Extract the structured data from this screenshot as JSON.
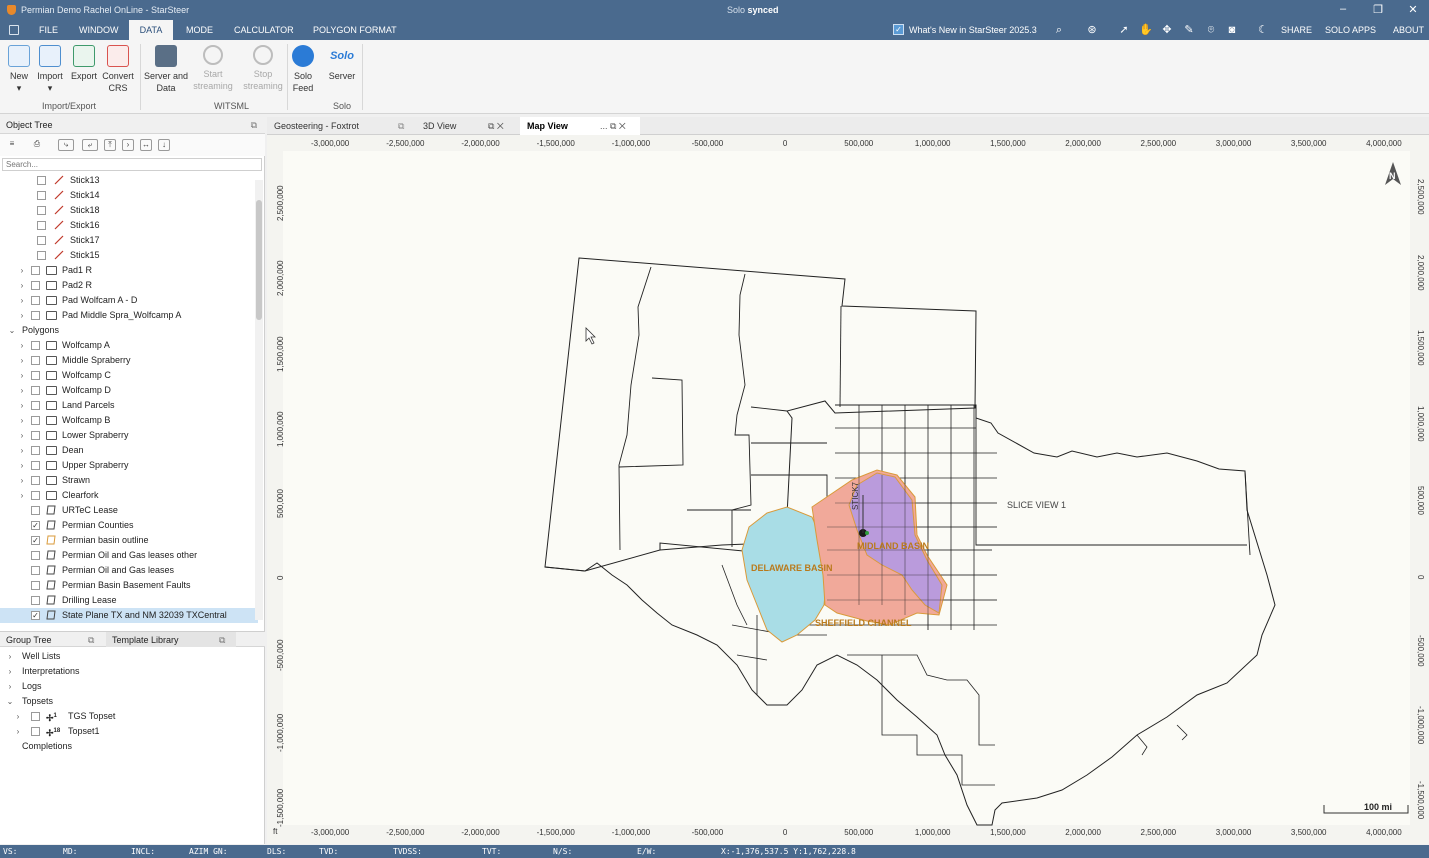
{
  "window": {
    "title": "Permian Demo Rachel OnLine - StarSteer",
    "sync_prefix": "Solo",
    "sync_status": "synced",
    "controls": [
      "–",
      "❐",
      "✕"
    ]
  },
  "menu": {
    "tabs": [
      "FILE",
      "WINDOW",
      "DATA",
      "MODE",
      "CALCULATOR",
      "POLYGON FORMAT"
    ],
    "active_tab": "DATA",
    "whats_new": "What's New in StarSteer 2025.3",
    "share": "SHARE",
    "solo_apps": "SOLO APPS",
    "about": "ABOUT"
  },
  "ribbon": {
    "groups": {
      "import_export": "Import/Export",
      "witsml": "WITSML",
      "solo": "Solo"
    },
    "buttons": {
      "new": [
        "New",
        "▾"
      ],
      "import": [
        "Import",
        "▾"
      ],
      "export": [
        "Export",
        ""
      ],
      "convert": [
        "Convert",
        "CRS"
      ],
      "server": [
        "Server and",
        "Data"
      ],
      "start": [
        "Start",
        "streaming"
      ],
      "stop": [
        "Stop",
        "streaming"
      ],
      "solo_feed": [
        "Solo",
        "Feed"
      ],
      "solo_server": [
        "Server",
        ""
      ]
    },
    "solo_logo_text": "Solo",
    "colors": {
      "new": "#6aa3d8",
      "import": "#4f8fcf",
      "export": "#3f9a6c",
      "convert": "#d9534f",
      "server": "#5a6f86",
      "solo": "#2b7bd6"
    }
  },
  "object_tree": {
    "title": "Object Tree",
    "search_placeholder": "Search...",
    "rows": [
      {
        "label": "Stick13",
        "type": "stick",
        "indent": 2,
        "expander": "",
        "checked": false
      },
      {
        "label": "Stick14",
        "type": "stick",
        "indent": 2,
        "expander": "",
        "checked": false
      },
      {
        "label": "Stick18",
        "type": "stick",
        "indent": 2,
        "expander": "",
        "checked": false
      },
      {
        "label": "Stick16",
        "type": "stick",
        "indent": 2,
        "expander": "",
        "checked": false
      },
      {
        "label": "Stick17",
        "type": "stick",
        "indent": 2,
        "expander": "",
        "checked": false
      },
      {
        "label": "Stick15",
        "type": "stick",
        "indent": 2,
        "expander": "",
        "checked": false
      },
      {
        "label": "Pad1 R",
        "type": "folder",
        "indent": 1,
        "expander": "›",
        "checked": false
      },
      {
        "label": "Pad2 R",
        "type": "folder",
        "indent": 1,
        "expander": "›",
        "checked": false
      },
      {
        "label": "Pad Wolfcam A - D",
        "type": "folder",
        "indent": 1,
        "expander": "›",
        "checked": false
      },
      {
        "label": "Pad Middle Spra_Wolfcamp A",
        "type": "folder",
        "indent": 1,
        "expander": "›",
        "checked": false
      },
      {
        "label": "Polygons",
        "type": "group",
        "indent": 0,
        "expander": "⌄",
        "checked": null
      },
      {
        "label": "Wolfcamp A",
        "type": "folder",
        "indent": 1,
        "expander": "›",
        "checked": false
      },
      {
        "label": "Middle Spraberry",
        "type": "folder",
        "indent": 1,
        "expander": "›",
        "checked": false
      },
      {
        "label": "Wolfcamp C",
        "type": "folder",
        "indent": 1,
        "expander": "›",
        "checked": false
      },
      {
        "label": "Wolfcamp D",
        "type": "folder",
        "indent": 1,
        "expander": "›",
        "checked": false
      },
      {
        "label": "Land Parcels",
        "type": "folder",
        "indent": 1,
        "expander": "›",
        "checked": false
      },
      {
        "label": "Wolfcamp B",
        "type": "folder",
        "indent": 1,
        "expander": "›",
        "checked": false
      },
      {
        "label": "Lower Spraberry",
        "type": "folder",
        "indent": 1,
        "expander": "›",
        "checked": false
      },
      {
        "label": "Dean",
        "type": "folder",
        "indent": 1,
        "expander": "›",
        "checked": false
      },
      {
        "label": "Upper Spraberry",
        "type": "folder",
        "indent": 1,
        "expander": "›",
        "checked": false
      },
      {
        "label": "Strawn",
        "type": "folder",
        "indent": 1,
        "expander": "›",
        "checked": false
      },
      {
        "label": "Clearfork",
        "type": "folder",
        "indent": 1,
        "expander": "›",
        "checked": false
      },
      {
        "label": "URTeC Lease",
        "type": "polygon",
        "indent": 1,
        "expander": "",
        "checked": false
      },
      {
        "label": "Permian Counties",
        "type": "polygon",
        "indent": 1,
        "expander": "",
        "checked": true
      },
      {
        "label": "Permian basin outline",
        "type": "polygon-orange",
        "indent": 1,
        "expander": "",
        "checked": true
      },
      {
        "label": "Permian Oil and Gas leases other",
        "type": "polygon",
        "indent": 1,
        "expander": "",
        "checked": false
      },
      {
        "label": "Permian Oil and Gas leases",
        "type": "polygon",
        "indent": 1,
        "expander": "",
        "checked": false
      },
      {
        "label": "Permian Basin Basement Faults",
        "type": "polygon",
        "indent": 1,
        "expander": "",
        "checked": false
      },
      {
        "label": "Drilling Lease",
        "type": "polygon",
        "indent": 1,
        "expander": "",
        "checked": false
      },
      {
        "label": "State Plane TX and NM 32039 TXCentral",
        "type": "polygon",
        "indent": 1,
        "expander": "",
        "checked": true,
        "selected": true
      }
    ]
  },
  "group_tree": {
    "title": "Group Tree",
    "tab2": "Template Library",
    "rows": [
      {
        "label": "Well Lists",
        "indent": 0,
        "expander": "›",
        "checkbox": false,
        "sup": ""
      },
      {
        "label": "Interpretations",
        "indent": 0,
        "expander": "›",
        "checkbox": false,
        "sup": ""
      },
      {
        "label": "Logs",
        "indent": 0,
        "expander": "›",
        "checkbox": false,
        "sup": ""
      },
      {
        "label": "Topsets",
        "indent": 0,
        "expander": "⌄",
        "checkbox": false,
        "sup": ""
      },
      {
        "label": "TGS Topset",
        "indent": 1,
        "expander": "›",
        "checkbox": true,
        "sup": "1"
      },
      {
        "label": "Topset1",
        "indent": 1,
        "expander": "›",
        "checkbox": true,
        "sup": "18"
      },
      {
        "label": "Completions",
        "indent": 0,
        "expander": "",
        "checkbox": false,
        "sup": ""
      }
    ]
  },
  "view_tabs": [
    {
      "label": "Geosteering - Foxtrot",
      "active": false,
      "controls": "⧉"
    },
    {
      "label": "3D View",
      "active": false,
      "controls": "⧉  ✕"
    },
    {
      "label": "Map View",
      "active": true,
      "controls": "...  ⧉  ✕"
    }
  ],
  "map": {
    "x_ticks": [
      "-3,000,000",
      "-2,500,000",
      "-2,000,000",
      "-1,500,000",
      "-1,000,000",
      "-500,000",
      "0",
      "500,000",
      "1,000,000",
      "1,500,000",
      "2,000,000",
      "2,500,000",
      "3,000,000",
      "3,500,000",
      "4,000,000"
    ],
    "y_ticks": [
      "2,500,000",
      "2,000,000",
      "1,500,000",
      "1,000,000",
      "500,000",
      "0",
      "-500,000",
      "-1,000,000",
      "-1,500,000"
    ],
    "unit_label": "ft",
    "north_label": "N",
    "scale_label": "100 mi",
    "labels": {
      "slice": "SLICE VIEW 1",
      "delaware": "DELAWARE BASIN",
      "midland": "MIDLAND BASIN",
      "sheffield": "SHEFFIELD CHANNEL",
      "stick": "STICK7"
    },
    "colors": {
      "delaware": "#a9dde6",
      "midland": "#b89be0",
      "outline": "#f1a99a",
      "orange": "#d99a3a"
    }
  },
  "status": {
    "vs": "VS:",
    "md": "MD:",
    "incl": "INCL:",
    "azim": "AZIM GN:",
    "dls": "DLS:",
    "tvd": "TVD:",
    "tvdss": "TVDSS:",
    "tvt": "TVT:",
    "ns": "N/S:",
    "ew": "E/W:",
    "coords": "X:-1,376,537.5  Y:1,762,228.8"
  }
}
